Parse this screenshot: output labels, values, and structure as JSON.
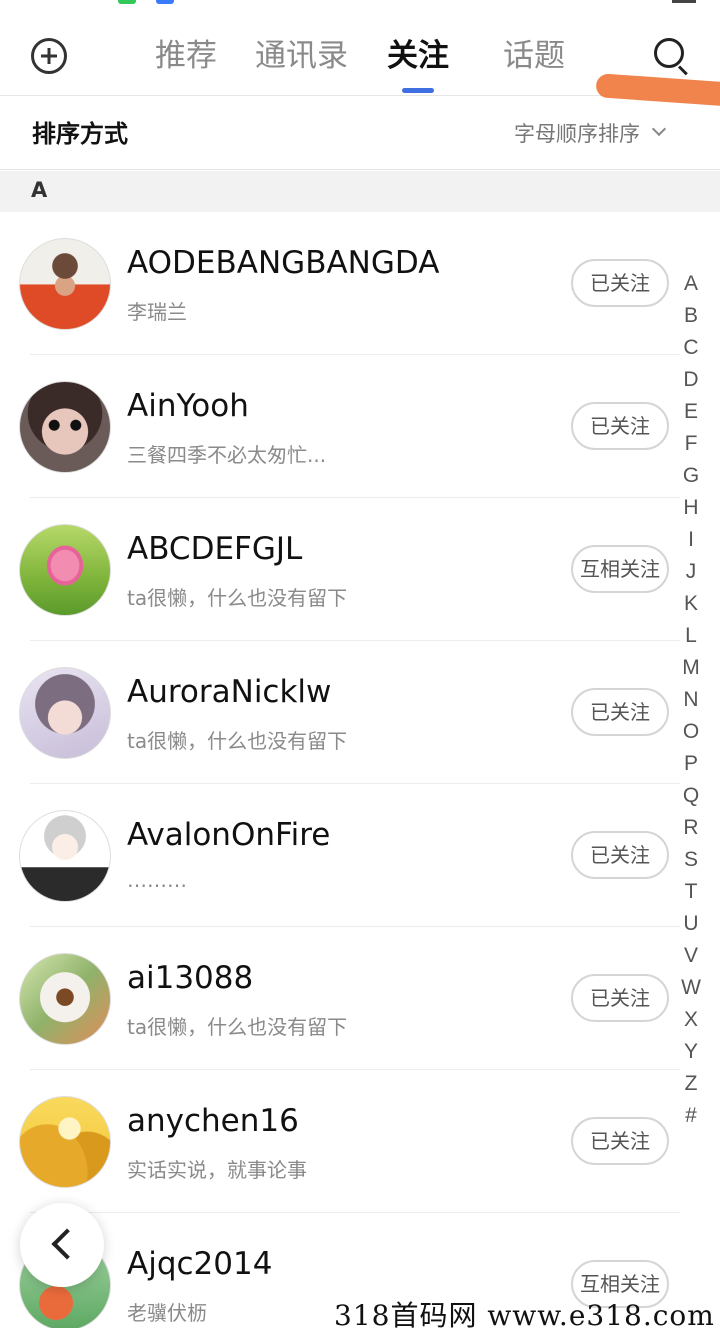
{
  "header": {
    "tabs": [
      {
        "label": "推荐"
      },
      {
        "label": "通讯录"
      },
      {
        "label": "关注"
      },
      {
        "label": "话题"
      }
    ]
  },
  "sort": {
    "title": "排序方式",
    "value": "字母顺序排序"
  },
  "section": {
    "letter": "A"
  },
  "contacts": [
    {
      "name": "AODEBANGBANGDA",
      "subtitle": "李瑞兰",
      "follow": "已关注"
    },
    {
      "name": "AinYooh",
      "subtitle": "三餐四季不必太匆忙...",
      "follow": "已关注"
    },
    {
      "name": "ABCDEFGJL",
      "subtitle": "ta很懒，什么也没有留下",
      "follow": "互相关注"
    },
    {
      "name": "AuroraNicklw",
      "subtitle": "ta很懒，什么也没有留下",
      "follow": "已关注"
    },
    {
      "name": "AvalonOnFire",
      "subtitle": "………",
      "follow": "已关注"
    },
    {
      "name": "ai13088",
      "subtitle": "ta很懒，什么也没有留下",
      "follow": "已关注"
    },
    {
      "name": "anychen16",
      "subtitle": "实话实说，就事论事",
      "follow": "已关注"
    },
    {
      "name": "Ajqc2014",
      "subtitle": "老骥伏枥",
      "follow": "互相关注"
    }
  ],
  "index_letters": [
    "A",
    "B",
    "C",
    "D",
    "E",
    "F",
    "G",
    "H",
    "I",
    "J",
    "K",
    "L",
    "M",
    "N",
    "O",
    "P",
    "Q",
    "R",
    "S",
    "T",
    "U",
    "V",
    "W",
    "X",
    "Y",
    "Z",
    "#"
  ],
  "watermark": "318首码网 www.e318.com",
  "colors": {
    "accent": "#3f6fe0",
    "highlight_mark": "#f07a3e"
  }
}
